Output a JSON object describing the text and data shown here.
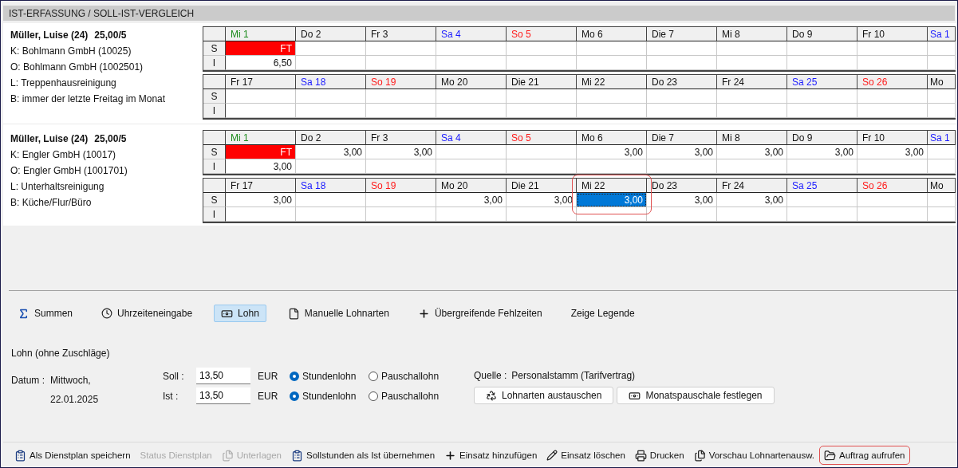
{
  "panel_title": "IST-ERFASSUNG / SOLL-IST-VERGLEICH",
  "blocks": [
    {
      "employee": "Müller, Luise (24)",
      "hours": "25,00/5",
      "details": [
        "K: Bohlmann GmbH (10025)",
        "O: Bohlmann GmbH (1002501)",
        "L: Treppenhausreinigung",
        "B: immer der letzte Freitag im Monat"
      ],
      "weeks": [
        {
          "row_labels": [
            "S",
            "I"
          ],
          "days": [
            {
              "label": "Mi 1",
              "kind": "holiday",
              "soll": "FT",
              "ist": "6,50",
              "absence": true,
              "selected": false,
              "circled": false
            },
            {
              "label": "Do 2",
              "kind": "weekday",
              "absence": false,
              "selected": false,
              "circled": false
            },
            {
              "label": "Fr 3",
              "kind": "weekday",
              "absence": false,
              "selected": false,
              "circled": false
            },
            {
              "label": "Sa 4",
              "kind": "saturday",
              "absence": false,
              "selected": false,
              "circled": false
            },
            {
              "label": "So 5",
              "kind": "sunday",
              "absence": false,
              "selected": false,
              "circled": false
            },
            {
              "label": "Mo 6",
              "kind": "weekday",
              "absence": false,
              "selected": false,
              "circled": false
            },
            {
              "label": "Die 7",
              "kind": "weekday",
              "absence": false,
              "selected": false,
              "circled": false
            },
            {
              "label": "Mi 8",
              "kind": "weekday",
              "absence": false,
              "selected": false,
              "circled": false
            },
            {
              "label": "Do 9",
              "kind": "weekday",
              "absence": false,
              "selected": false,
              "circled": false
            },
            {
              "label": "Fr 10",
              "kind": "weekday",
              "absence": false,
              "selected": false,
              "circled": false
            },
            {
              "label": "Sa 1",
              "kind": "saturday",
              "absence": false,
              "selected": false,
              "circled": false
            }
          ]
        },
        {
          "row_labels": [
            "S",
            "I"
          ],
          "days": [
            {
              "label": "Fr 17",
              "kind": "weekday",
              "absence": false,
              "selected": false,
              "circled": false
            },
            {
              "label": "Sa 18",
              "kind": "saturday",
              "absence": false,
              "selected": false,
              "circled": false
            },
            {
              "label": "So 19",
              "kind": "sunday",
              "absence": false,
              "selected": false,
              "circled": false
            },
            {
              "label": "Mo 20",
              "kind": "weekday",
              "absence": false,
              "selected": false,
              "circled": false
            },
            {
              "label": "Die 21",
              "kind": "weekday",
              "absence": false,
              "selected": false,
              "circled": false
            },
            {
              "label": "Mi 22",
              "kind": "weekday",
              "absence": false,
              "selected": false,
              "circled": false
            },
            {
              "label": "Do 23",
              "kind": "weekday",
              "absence": false,
              "selected": false,
              "circled": false
            },
            {
              "label": "Fr 24",
              "kind": "weekday",
              "absence": false,
              "selected": false,
              "circled": false
            },
            {
              "label": "Sa 25",
              "kind": "saturday",
              "absence": false,
              "selected": false,
              "circled": false
            },
            {
              "label": "So 26",
              "kind": "sunday",
              "absence": false,
              "selected": false,
              "circled": false
            },
            {
              "label": "Mo",
              "kind": "weekday",
              "absence": false,
              "selected": false,
              "circled": false
            }
          ]
        }
      ]
    },
    {
      "employee": "Müller, Luise (24)",
      "hours": "25,00/5",
      "details": [
        "K: Engler GmbH (10017)",
        "O: Engler GmbH (1001701)",
        "L: Unterhaltsreinigung",
        "B: Küche/Flur/Büro"
      ],
      "weeks": [
        {
          "row_labels": [
            "S",
            "I"
          ],
          "days": [
            {
              "label": "Mi 1",
              "kind": "holiday",
              "soll": "FT",
              "ist": "3,00",
              "absence": true,
              "selected": false,
              "circled": false
            },
            {
              "label": "Do 2",
              "kind": "weekday",
              "soll": "3,00",
              "absence": false,
              "selected": false,
              "circled": false
            },
            {
              "label": "Fr 3",
              "kind": "weekday",
              "soll": "3,00",
              "absence": false,
              "selected": false,
              "circled": false
            },
            {
              "label": "Sa 4",
              "kind": "saturday",
              "absence": false,
              "selected": false,
              "circled": false
            },
            {
              "label": "So 5",
              "kind": "sunday",
              "absence": false,
              "selected": false,
              "circled": false
            },
            {
              "label": "Mo 6",
              "kind": "weekday",
              "soll": "3,00",
              "absence": false,
              "selected": false,
              "circled": false
            },
            {
              "label": "Die 7",
              "kind": "weekday",
              "soll": "3,00",
              "absence": false,
              "selected": false,
              "circled": false
            },
            {
              "label": "Mi 8",
              "kind": "weekday",
              "soll": "3,00",
              "absence": false,
              "selected": false,
              "circled": false
            },
            {
              "label": "Do 9",
              "kind": "weekday",
              "soll": "3,00",
              "absence": false,
              "selected": false,
              "circled": false
            },
            {
              "label": "Fr 10",
              "kind": "weekday",
              "soll": "3,00",
              "absence": false,
              "selected": false,
              "circled": false
            },
            {
              "label": "Sa 1",
              "kind": "saturday",
              "absence": false,
              "selected": false,
              "circled": false
            }
          ]
        },
        {
          "row_labels": [
            "S",
            "I"
          ],
          "days": [
            {
              "label": "Fr 17",
              "kind": "weekday",
              "soll": "3,00",
              "absence": false,
              "selected": false,
              "circled": false
            },
            {
              "label": "Sa 18",
              "kind": "saturday",
              "absence": false,
              "selected": false,
              "circled": false
            },
            {
              "label": "So 19",
              "kind": "sunday",
              "absence": false,
              "selected": false,
              "circled": false
            },
            {
              "label": "Mo 20",
              "kind": "weekday",
              "soll": "3,00",
              "absence": false,
              "selected": false,
              "circled": false
            },
            {
              "label": "Die 21",
              "kind": "weekday",
              "soll": "3,00",
              "absence": false,
              "selected": false,
              "circled": false
            },
            {
              "label": "Mi 22",
              "kind": "weekday",
              "soll": "3,00",
              "absence": false,
              "selected": true,
              "circled": true
            },
            {
              "label": "Do 23",
              "kind": "weekday",
              "soll": "3,00",
              "absence": false,
              "selected": false,
              "circled": false
            },
            {
              "label": "Fr 24",
              "kind": "weekday",
              "soll": "3,00",
              "absence": false,
              "selected": false,
              "circled": false
            },
            {
              "label": "Sa 25",
              "kind": "saturday",
              "absence": false,
              "selected": false,
              "circled": false
            },
            {
              "label": "So 26",
              "kind": "sunday",
              "absence": false,
              "selected": false,
              "circled": false
            },
            {
              "label": "Mo",
              "kind": "weekday",
              "absence": false,
              "selected": false,
              "circled": false
            }
          ]
        }
      ]
    }
  ],
  "tabs": [
    {
      "label": "Summen",
      "selected": false
    },
    {
      "label": "Uhrzeiteneingabe",
      "selected": false
    },
    {
      "label": "Lohn",
      "selected": true
    },
    {
      "label": "Manuelle Lohnarten",
      "selected": false
    },
    {
      "label": "Übergreifende Fehlzeiten",
      "selected": false
    },
    {
      "label": "Zeige Legende",
      "selected": false
    }
  ],
  "wage": {
    "title": "Lohn (ohne Zuschläge)",
    "date_label": "Datum :",
    "weekday": "Mittwoch,",
    "date": "22.01.2025",
    "rows": [
      {
        "label": "Soll :",
        "value": "13,50",
        "currency": "EUR",
        "options": [
          {
            "label": "Stundenlohn",
            "selected": true
          },
          {
            "label": "Pauschallohn",
            "selected": false
          }
        ]
      },
      {
        "label": "Ist :",
        "value": "13,50",
        "currency": "EUR",
        "options": [
          {
            "label": "Stundenlohn",
            "selected": true
          },
          {
            "label": "Pauschallohn",
            "selected": false
          }
        ]
      }
    ],
    "source_label": "Quelle :",
    "source": "Personalstamm (Tarifvertrag)",
    "buttons": [
      {
        "label": "Lohnarten austauschen"
      },
      {
        "label": "Monatspauschale festlegen"
      }
    ]
  },
  "toolbar": [
    {
      "label": "Als Dienstplan speichern",
      "disabled": false,
      "circled": false
    },
    {
      "label": "Status Dienstplan",
      "disabled": true,
      "circled": false
    },
    {
      "label": "Unterlagen",
      "disabled": true,
      "circled": false
    },
    {
      "label": "Sollstunden als Ist übernehmen",
      "disabled": false,
      "circled": false
    },
    {
      "label": "Einsatz hinzufügen",
      "disabled": false,
      "circled": false
    },
    {
      "label": "Einsatz löschen",
      "disabled": false,
      "circled": false
    },
    {
      "label": "Drucken",
      "disabled": false,
      "circled": false
    },
    {
      "label": "Vorschau Lohnartenausw.",
      "disabled": false,
      "circled": false
    },
    {
      "label": "Auftrag aufrufen",
      "disabled": false,
      "circled": true
    }
  ]
}
